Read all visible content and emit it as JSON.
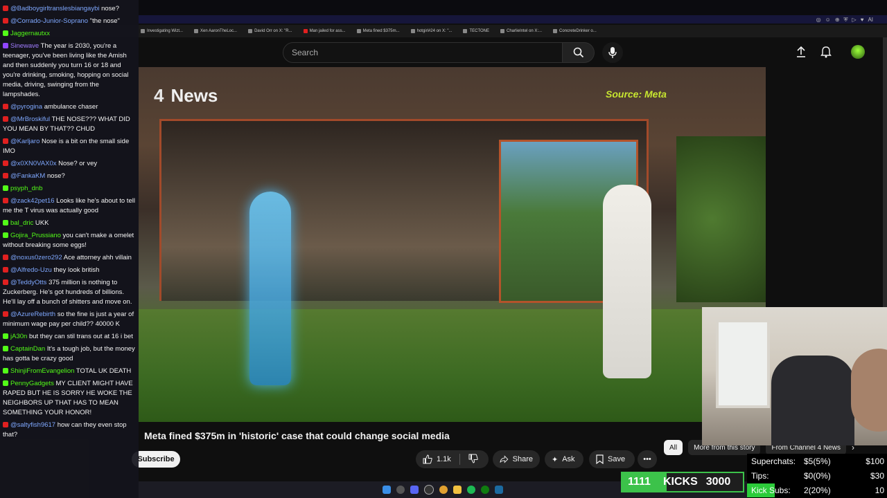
{
  "browser": {
    "tabs": [
      {
        "label": "Investigating Wizt..."
      },
      {
        "label": "Xen AaronTheLoc..."
      },
      {
        "label": "David Orr on X: \"R..."
      },
      {
        "label": "Man jailed for ass..."
      },
      {
        "label": "Meta fined $375m..."
      },
      {
        "label": "hotgirl#24 on X: \"..."
      },
      {
        "label": "TECTONE"
      },
      {
        "label": "CharlieIntel on X:..."
      },
      {
        "label": "ConcreteDrinker o..."
      }
    ],
    "ext_label": "AI"
  },
  "header": {
    "search_placeholder": "Search"
  },
  "video": {
    "logo_number": "4",
    "logo_text": "News",
    "source_text": "Source: Meta"
  },
  "info": {
    "title": "Meta fined $375m in 'historic' case that could change social media",
    "subscribe": "Subscribe",
    "likes": "1.1k",
    "share": "Share",
    "ask": "Ask",
    "save": "Save",
    "chips": [
      "All",
      "More from this story",
      "From Channel 4 News"
    ]
  },
  "chat": [
    {
      "platform": "yt",
      "user": "@Badboygirltranslesbiangaybi",
      "text": "nose?"
    },
    {
      "platform": "yt",
      "user": "@Corrado-Junior-Soprano",
      "text": "\"the nose\""
    },
    {
      "platform": "kick",
      "user": "Jaggernautxx",
      "text": ""
    },
    {
      "platform": "tw",
      "user": "Sinewave",
      "text": "The year is 2030, you're a teenager, you've been living like the Amish and then suddenly you turn 16 or 18 and you're drinking, smoking, hopping on social media, driving, swinging from the lampshades."
    },
    {
      "platform": "yt",
      "user": "@pyrogina",
      "text": "ambulance chaser"
    },
    {
      "platform": "yt",
      "user": "@MrBroskiful",
      "text": "THE NOSE??? WHAT DID YOU MEAN BY THAT?? CHUD"
    },
    {
      "platform": "yt",
      "user": "@Karljaro",
      "text": "Nose is a bit on the small side IMO"
    },
    {
      "platform": "yt",
      "user": "@x0XN0VAX0x",
      "text": "Nose? or vey"
    },
    {
      "platform": "yt",
      "user": "@FankaKM",
      "text": "nose?"
    },
    {
      "platform": "kick",
      "user": "psyph_dnb",
      "text": ""
    },
    {
      "platform": "yt",
      "user": "@zack42pet16",
      "text": "Looks like he's about to tell me the T virus was actually good"
    },
    {
      "platform": "kick",
      "user": "bal_dric",
      "text": "UKK"
    },
    {
      "platform": "kick",
      "user": "Gojira_Prussiano",
      "text": "you can't make a omelet without breaking some eggs!"
    },
    {
      "platform": "yt",
      "user": "@noxus0zero292",
      "text": "Ace attorney ahh villain"
    },
    {
      "platform": "yt",
      "user": "@Alfredo-Uzu",
      "text": "they look british"
    },
    {
      "platform": "yt",
      "user": "@TeddyOtts",
      "text": "375 million is nothing to Zuckerberg. He's got hundreds of billions. He'll lay off a bunch of shitters and move on."
    },
    {
      "platform": "yt",
      "user": "@AzureRebirth",
      "text": "so the fine is just a year of minimum wage pay per child?? 40000 K"
    },
    {
      "platform": "kick",
      "user": "jA30n",
      "text": "but they can stil trans out at 16 i bet"
    },
    {
      "platform": "kick",
      "user": "CaptainDan",
      "text": "It's a tough job, but the money has gotta be crazy good"
    },
    {
      "platform": "kick",
      "user": "ShinjiFromEvangelion",
      "text": "TOTAL UK DEATH"
    },
    {
      "platform": "kick",
      "user": "PennyGadgets",
      "text": "MY CLIENT MIGHT HAVE RAPED BUT HE IS SORRY HE WOKE THE NEIGHBORS UP THAT HAS TO MEAN SOMETHING YOUR HONOR!"
    },
    {
      "platform": "yt",
      "user": "@saltyfish9617",
      "text": "how can they even stop that?"
    }
  ],
  "stats": {
    "rows": [
      {
        "label": "Superchats:",
        "value": "$5(5%)",
        "goal": "$100",
        "fraction": 0.0
      },
      {
        "label": "Tips:",
        "value": "$0(0%)",
        "goal": "$30",
        "fraction": 0.0
      },
      {
        "label": "Kick Subs:",
        "value": "2(20%)",
        "goal": "10",
        "fraction": 0.2
      }
    ],
    "kicks_current": "1111",
    "kicks_label": "KICKS",
    "kicks_goal": "3000",
    "kicks_fraction": 0.37
  },
  "colors": {
    "accent_green": "#53fc18",
    "source_yellow": "#c7e630",
    "yt_red": "#e02020"
  }
}
